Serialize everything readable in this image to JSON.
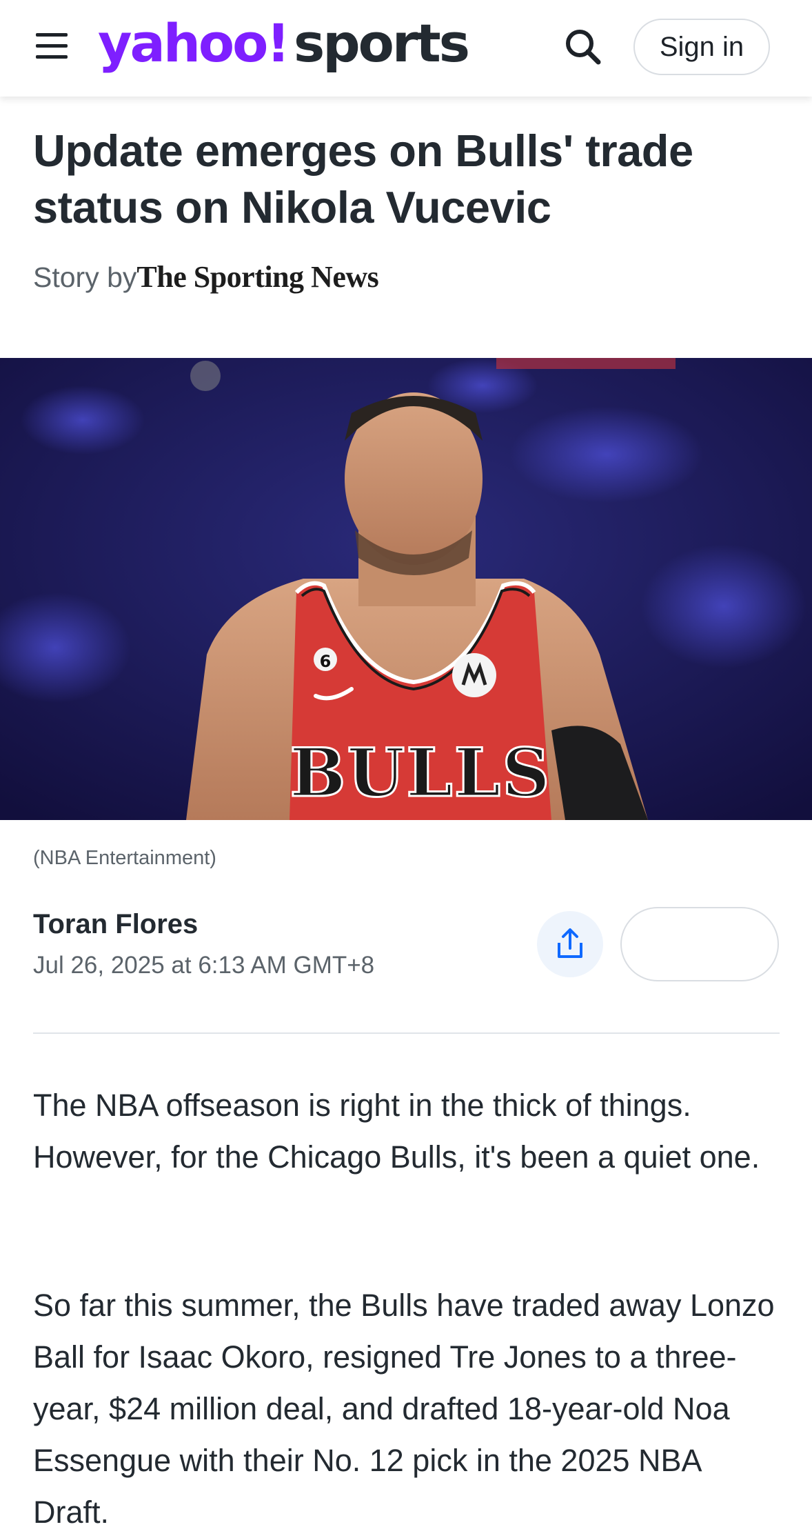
{
  "header": {
    "logo_yahoo": "yahoo!",
    "logo_sports": "sports",
    "signin_label": "Sign in",
    "brand_color": "#7e1fff",
    "icons": [
      "menu-icon",
      "search-icon"
    ]
  },
  "article": {
    "title": "Update emerges on Bulls' trade status on Nikola Vucevic",
    "byline_prefix": "Story by",
    "byline_source": "The Sporting News",
    "image_caption": "(NBA Entertainment)",
    "image_jersey_text": "BULLS",
    "image_jersey_number": "6",
    "author": "Toran Flores",
    "date": "Jul 26, 2025 at 6:13 AM GMT+8",
    "share_icon": "share-icon",
    "paragraphs": [
      "The NBA offseason is right in the thick of things. However, for the Chicago Bulls, it's been a quiet one.",
      "So far this summer, the Bulls have traded away Lonzo Ball for Isaac Okoro, resigned Tre Jones to a three-year, $24 million deal, and drafted 18-year-old Noa Essengue with their No. 12 pick in the 2025 NBA Draft."
    ]
  }
}
